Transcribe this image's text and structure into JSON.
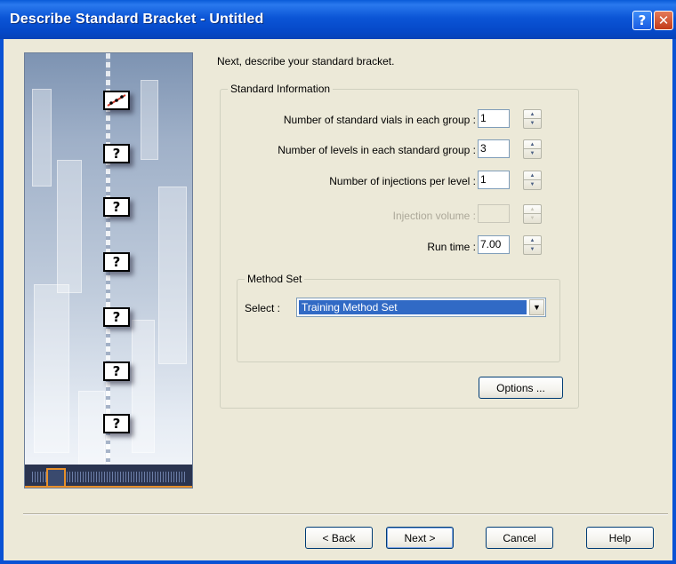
{
  "window": {
    "title": "Describe Standard Bracket - Untitled",
    "help_glyph": "?",
    "close_glyph": "✕"
  },
  "intro_text": "Next, describe your standard bracket.",
  "standard_info": {
    "group_label": "Standard Information",
    "rows": [
      {
        "label": "Number of standard vials in each group :",
        "value": "1",
        "enabled": true
      },
      {
        "label": "Number of levels in each standard group :",
        "value": "3",
        "enabled": true
      },
      {
        "label": "Number of injections per level :",
        "value": "1",
        "enabled": true
      },
      {
        "label": "Injection volume :",
        "value": "",
        "enabled": false
      },
      {
        "label": "Run time :",
        "value": "7.00",
        "enabled": true
      }
    ]
  },
  "method_set": {
    "group_label": "Method Set",
    "select_label": "Select :",
    "selected": "Training Method Set"
  },
  "options_button": "Options ...",
  "wizard_image": {
    "step_glyphs": [
      "/",
      "?",
      "?",
      "?",
      "?",
      "?",
      "?"
    ]
  },
  "footer": {
    "back": "< Back",
    "next": "Next >",
    "cancel": "Cancel",
    "help": "Help"
  },
  "colors": {
    "titlebar": "#0A5BD8",
    "dialog_bg": "#ECE9D8",
    "selection": "#316AC5"
  }
}
